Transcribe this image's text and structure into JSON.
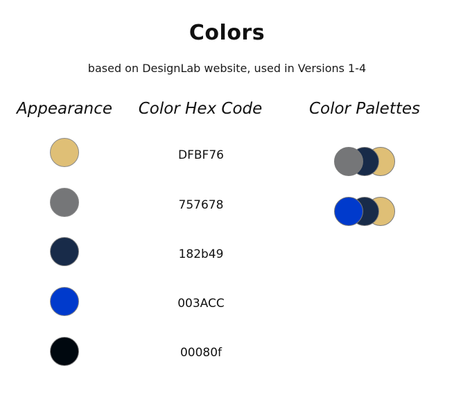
{
  "title": "Colors",
  "subtitle": "based on DesignLab website, used in Versions 1-4",
  "headers": {
    "appearance": "Appearance",
    "hex": "Color Hex Code",
    "palettes": "Color Palettes"
  },
  "colors": [
    {
      "code": "DFBF76",
      "hex": "#DFBF76"
    },
    {
      "code": "757678",
      "hex": "#757678"
    },
    {
      "code": "182b49",
      "hex": "#182b49"
    },
    {
      "code": "003ACC",
      "hex": "#003ACC"
    },
    {
      "code": "00080f",
      "hex": "#00080f"
    }
  ],
  "palettes": [
    [
      "#757678",
      "#182b49",
      "#DFBF76"
    ],
    [
      "#003ACC",
      "#182b49",
      "#DFBF76"
    ]
  ]
}
